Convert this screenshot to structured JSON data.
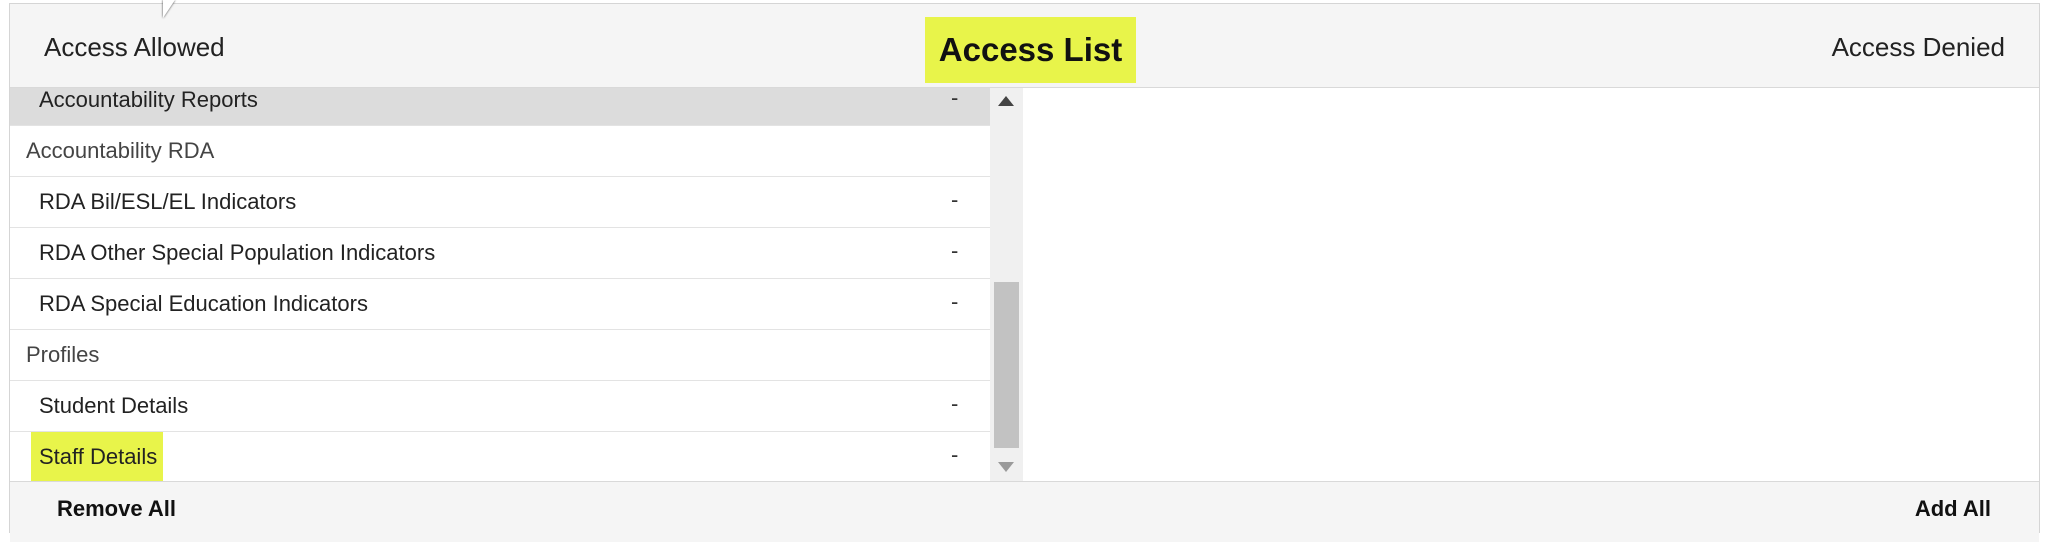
{
  "header": {
    "left_label": "Access Allowed",
    "title": "Access List",
    "right_label": "Access Denied"
  },
  "allowed_list": [
    {
      "label": "Accountability Reports",
      "remove": "-"
    },
    {
      "label": "Accountability RDA"
    },
    {
      "label": "RDA Bil/ESL/EL Indicators",
      "remove": "-"
    },
    {
      "label": "RDA Other Special Population Indicators",
      "remove": "-"
    },
    {
      "label": "RDA Special Education Indicators",
      "remove": "-"
    },
    {
      "label": "Profiles"
    },
    {
      "label": "Student Details",
      "remove": "-"
    },
    {
      "label": "Staff Details",
      "remove": "-"
    }
  ],
  "footer": {
    "remove_all": "Remove All",
    "add_all": "Add All"
  },
  "colors": {
    "highlight": "#e8f44a",
    "header_bg": "#f5f5f5",
    "selected_row": "#dcdcdc"
  }
}
